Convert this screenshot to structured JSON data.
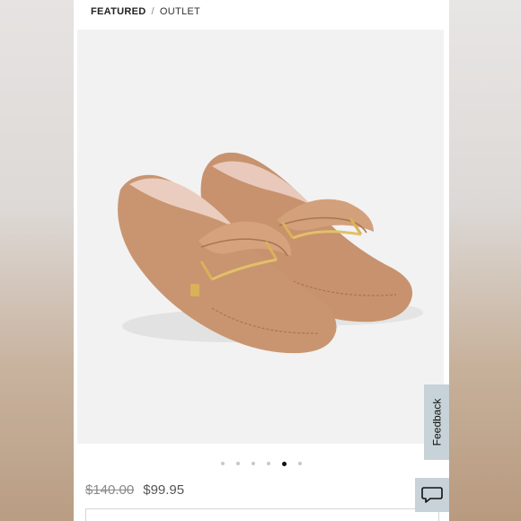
{
  "breadcrumb": {
    "featured": "FEATURED",
    "separator": "/",
    "outlet": "OUTLET"
  },
  "product": {
    "image_alt": "Tan suede driver loafers with gold bit hardware",
    "carousel": {
      "total": 6,
      "active_index": 4
    },
    "price_original": "$140.00",
    "price_sale": "$99.95"
  },
  "feedback": {
    "label": "Feedback"
  },
  "chat": {
    "icon": "chat-bubble-icon"
  },
  "colors": {
    "suede": "#c99570",
    "image_bg": "#f2f2f2",
    "feedback_bg": "#c7d3d8"
  }
}
